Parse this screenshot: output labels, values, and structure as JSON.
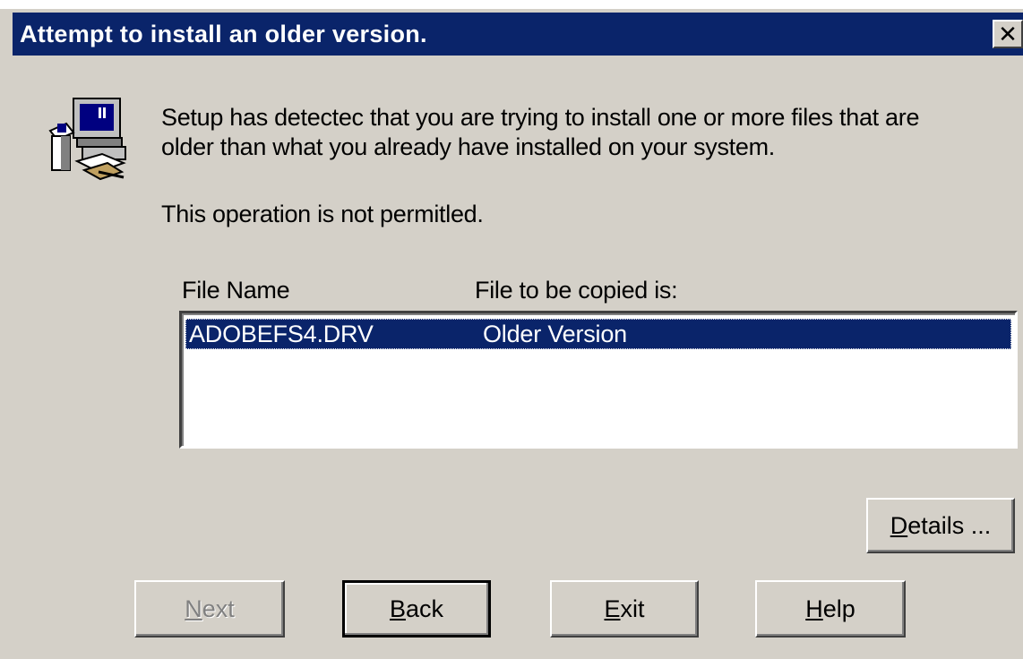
{
  "dialog": {
    "title": "Attempt to install an older version.",
    "close_glyph": "✕"
  },
  "message": {
    "line1": "Setup has detectec that you are trying to install one or more files that are",
    "line2": "older than what you already have installed on your system.",
    "line3": "This operation is not permitled."
  },
  "file_list": {
    "headers": {
      "file_name": "File Name",
      "file_to_be_copied": "File to be copied is:"
    },
    "rows": [
      {
        "file_name": "ADOBEFS4.DRV",
        "status": "Older Version",
        "selected": true
      }
    ]
  },
  "buttons": {
    "details": {
      "mnemonic": "D",
      "rest": "etails ..."
    },
    "next": {
      "mnemonic": "N",
      "rest": "ext",
      "enabled": false
    },
    "back": {
      "mnemonic": "B",
      "rest": "ack"
    },
    "exit": {
      "mnemonic": "E",
      "rest": "xit"
    },
    "help": {
      "mnemonic": "H",
      "rest": "elp"
    }
  },
  "icons": {
    "setup": "setup-computer-icon",
    "close": "close-icon"
  },
  "colors": {
    "titlebar": "#0a246a",
    "face": "#d4d0c8",
    "selection": "#0a246a"
  }
}
